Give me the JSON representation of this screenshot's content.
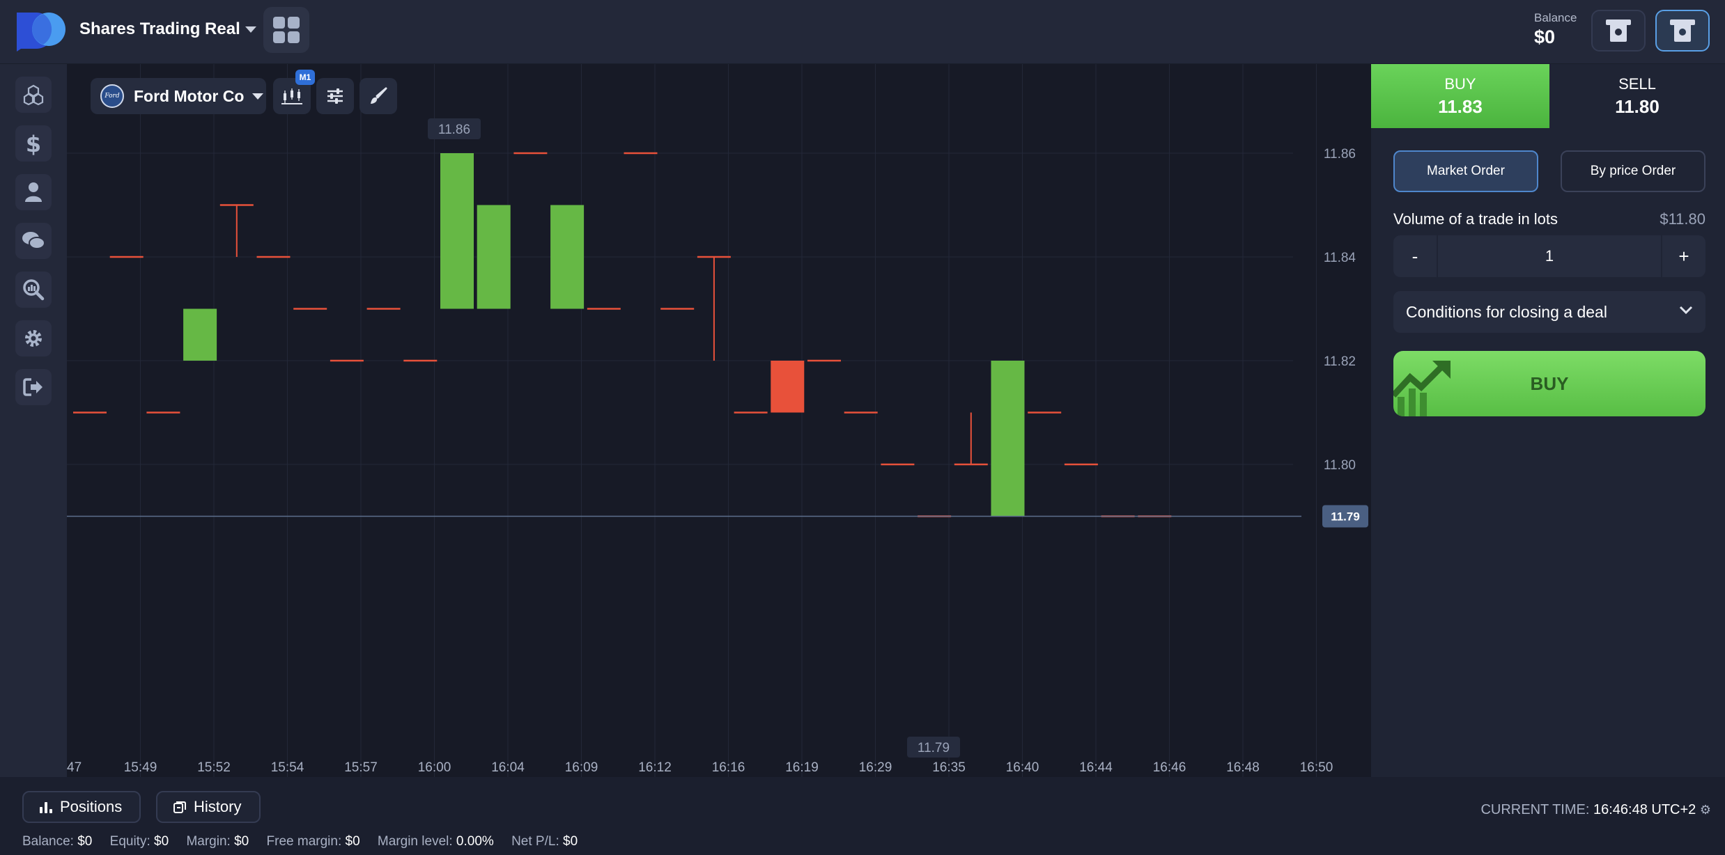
{
  "header": {
    "account_title": "Shares Trading Real",
    "balance_label": "Balance",
    "balance_value": "$0"
  },
  "sidebar": {
    "items": [
      "cubes-icon",
      "dollar-icon",
      "user-icon",
      "chat-icon",
      "analytics-icon",
      "gear-icon",
      "logout-icon"
    ]
  },
  "toolbar": {
    "asset_name": "Ford Motor Co",
    "timeframe_badge": "M1"
  },
  "chart_data": {
    "type": "candlestick",
    "price_ticks": [
      "11.86",
      "11.84",
      "11.82",
      "11.80"
    ],
    "tick_values": [
      11.86,
      11.84,
      11.82,
      11.8
    ],
    "time_labels": [
      "47",
      "15:49",
      "15:52",
      "15:54",
      "15:57",
      "16:00",
      "16:04",
      "16:09",
      "16:12",
      "16:16",
      "16:19",
      "16:29",
      "16:35",
      "16:40",
      "16:44",
      "16:46",
      "16:48",
      "16:50"
    ],
    "current_price": "11.79",
    "current_price_value": 11.79,
    "high_label": "11.86",
    "low_label": "11.79",
    "ylim": [
      11.77,
      11.87
    ],
    "candles": [
      {
        "o": 11.81,
        "h": 11.81,
        "l": 11.81,
        "c": 11.81
      },
      {
        "o": 11.84,
        "h": 11.84,
        "l": 11.84,
        "c": 11.84
      },
      {
        "o": 11.81,
        "h": 11.81,
        "l": 11.81,
        "c": 11.81
      },
      {
        "o": 11.82,
        "h": 11.83,
        "l": 11.82,
        "c": 11.83
      },
      {
        "o": 11.85,
        "h": 11.85,
        "l": 11.84,
        "c": 11.85
      },
      {
        "o": 11.84,
        "h": 11.84,
        "l": 11.84,
        "c": 11.84
      },
      {
        "o": 11.83,
        "h": 11.83,
        "l": 11.83,
        "c": 11.83
      },
      {
        "o": 11.82,
        "h": 11.82,
        "l": 11.82,
        "c": 11.82
      },
      {
        "o": 11.83,
        "h": 11.83,
        "l": 11.83,
        "c": 11.83
      },
      {
        "o": 11.82,
        "h": 11.82,
        "l": 11.82,
        "c": 11.82
      },
      {
        "o": 11.83,
        "h": 11.86,
        "l": 11.83,
        "c": 11.86
      },
      {
        "o": 11.83,
        "h": 11.85,
        "l": 11.83,
        "c": 11.85
      },
      {
        "o": 11.86,
        "h": 11.86,
        "l": 11.86,
        "c": 11.86
      },
      {
        "o": 11.83,
        "h": 11.85,
        "l": 11.83,
        "c": 11.85
      },
      {
        "o": 11.83,
        "h": 11.83,
        "l": 11.83,
        "c": 11.83
      },
      {
        "o": 11.86,
        "h": 11.86,
        "l": 11.86,
        "c": 11.86
      },
      {
        "o": 11.83,
        "h": 11.83,
        "l": 11.83,
        "c": 11.83
      },
      {
        "o": 11.84,
        "h": 11.84,
        "l": 11.82,
        "c": 11.84
      },
      {
        "o": 11.81,
        "h": 11.81,
        "l": 11.81,
        "c": 11.81
      },
      {
        "o": 11.82,
        "h": 11.82,
        "l": 11.81,
        "c": 11.81
      },
      {
        "o": 11.82,
        "h": 11.82,
        "l": 11.82,
        "c": 11.82
      },
      {
        "o": 11.81,
        "h": 11.81,
        "l": 11.81,
        "c": 11.81
      },
      {
        "o": 11.8,
        "h": 11.8,
        "l": 11.8,
        "c": 11.8
      },
      {
        "o": 11.79,
        "h": 11.79,
        "l": 11.79,
        "c": 11.79
      },
      {
        "o": 11.8,
        "h": 11.81,
        "l": 11.8,
        "c": 11.8
      },
      {
        "o": 11.79,
        "h": 11.82,
        "l": 11.79,
        "c": 11.82
      },
      {
        "o": 11.81,
        "h": 11.81,
        "l": 11.81,
        "c": 11.81
      },
      {
        "o": 11.8,
        "h": 11.8,
        "l": 11.8,
        "c": 11.8
      },
      {
        "o": 11.79,
        "h": 11.79,
        "l": 11.79,
        "c": 11.79
      },
      {
        "o": 11.79,
        "h": 11.79,
        "l": 11.79,
        "c": 11.79
      }
    ],
    "colors": {
      "up": "#66b845",
      "down": "#e8513a",
      "grid": "#232838"
    }
  },
  "panel": {
    "buy_label": "BUY",
    "buy_price": "11.83",
    "sell_label": "SELL",
    "sell_price": "11.80",
    "market_order": "Market Order",
    "price_order": "By price Order",
    "volume_label": "Volume of a trade in lots",
    "volume_value": "$11.80",
    "minus": "-",
    "lots": "1",
    "plus": "+",
    "conditions": "Conditions for closing a deal",
    "buy_button": "BUY"
  },
  "bottom": {
    "positions": "Positions",
    "history": "History",
    "current_time_label": "CURRENT TIME:",
    "current_time": "16:46:48 UTC+2",
    "balance_label": "Balance:",
    "balance": "$0",
    "equity_label": "Equity:",
    "equity": "$0",
    "margin_label": "Margin:",
    "margin": "$0",
    "free_margin_label": "Free margin:",
    "free_margin": "$0",
    "margin_level_label": "Margin level:",
    "margin_level": "0.00%",
    "net_pl_label": "Net P/L:",
    "net_pl": "$0"
  }
}
